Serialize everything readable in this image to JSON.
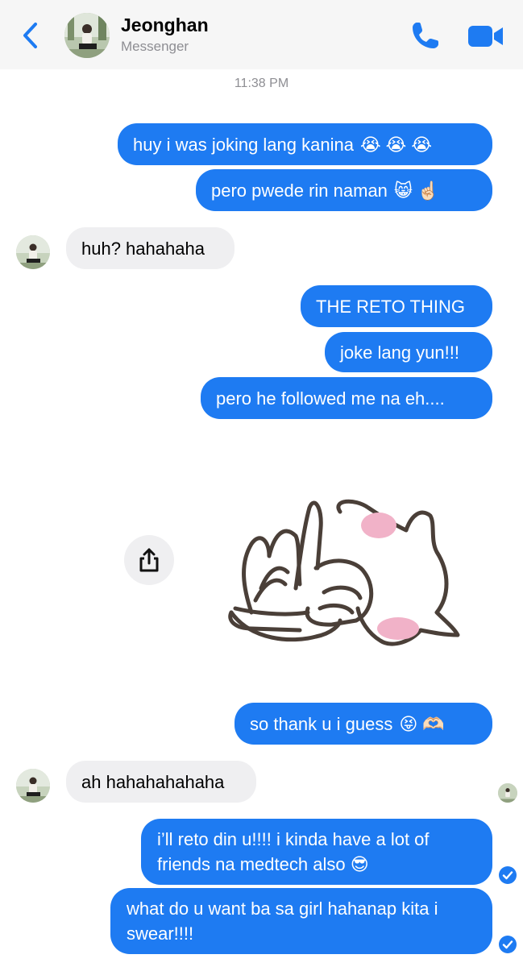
{
  "header": {
    "contact_name": "Jeonghan",
    "subtitle": "Messenger",
    "back_icon": "chevron-left-icon",
    "call_icon": "phone-icon",
    "video_icon": "video-camera-icon",
    "accent_color": "#1e7bf2"
  },
  "timestamp": "11:38 PM",
  "messages": [
    {
      "from": "me",
      "text": "huy i was joking lang kanina",
      "emoji": [
        "😭",
        "😭",
        "😭"
      ]
    },
    {
      "from": "me",
      "text": "pero pwede rin naman",
      "emoji": [
        "😸",
        "☝🏻"
      ]
    },
    {
      "from": "them",
      "text": "huh? hahahaha"
    },
    {
      "from": "me",
      "text": "THE RETO THING"
    },
    {
      "from": "me",
      "text": "joke lang yun!!!"
    },
    {
      "from": "me",
      "text": "pero he followed me na eh...."
    },
    {
      "from": "me",
      "type": "sticker",
      "sticker": "cat-paw-sticker"
    },
    {
      "from": "me",
      "text": "so thank u i guess",
      "emoji": [
        "😝",
        "🫶🏻"
      ]
    },
    {
      "from": "them",
      "text": "ah hahahahahaha"
    },
    {
      "from": "me",
      "text": "i’ll reto din u!!!! i kinda have a lot of friends na medtech also",
      "emoji": [
        "😎"
      ]
    },
    {
      "from": "me",
      "text": "what do u want ba sa girl hahanap kita i swear!!!!"
    }
  ],
  "share_icon": "share-icon",
  "seen_icon": "check-circle-icon",
  "colors": {
    "outgoing": "#1e7bf2",
    "incoming": "#efeff1",
    "meta_text": "#8e8e93"
  }
}
